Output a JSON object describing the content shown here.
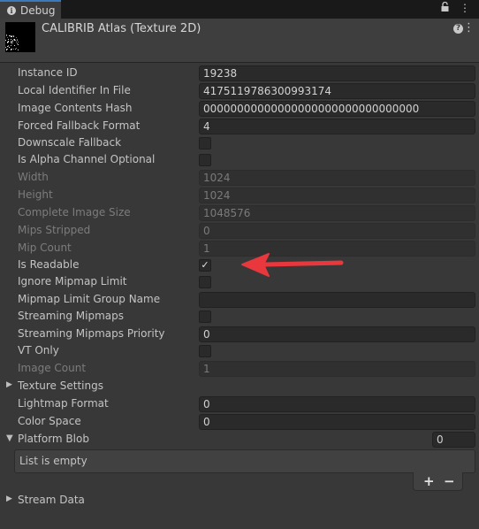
{
  "tab": {
    "title": "Debug"
  },
  "header": {
    "title": "CALIBRIB Atlas (Texture 2D)"
  },
  "properties": [
    {
      "label": "Instance ID",
      "kind": "field",
      "value": "19238",
      "enabled": true
    },
    {
      "label": "Local Identifier In File",
      "kind": "field",
      "value": "4175119786300993174",
      "enabled": true
    },
    {
      "label": "Image Contents Hash",
      "kind": "field",
      "value": "00000000000000000000000000000000",
      "enabled": true
    },
    {
      "label": "Forced Fallback Format",
      "kind": "field",
      "value": "4",
      "enabled": true
    },
    {
      "label": "Downscale Fallback",
      "kind": "checkbox",
      "checked": false,
      "enabled": true
    },
    {
      "label": "Is Alpha Channel Optional",
      "kind": "checkbox",
      "checked": false,
      "enabled": true
    },
    {
      "label": "Width",
      "kind": "field",
      "value": "1024",
      "enabled": false
    },
    {
      "label": "Height",
      "kind": "field",
      "value": "1024",
      "enabled": false
    },
    {
      "label": "Complete Image Size",
      "kind": "field",
      "value": "1048576",
      "enabled": false
    },
    {
      "label": "Mips Stripped",
      "kind": "field",
      "value": "0",
      "enabled": false
    },
    {
      "label": "Mip Count",
      "kind": "field",
      "value": "1",
      "enabled": false
    },
    {
      "label": "Is Readable",
      "kind": "checkbox",
      "checked": true,
      "enabled": true
    },
    {
      "label": "Ignore Mipmap Limit",
      "kind": "checkbox",
      "checked": false,
      "enabled": true
    },
    {
      "label": "Mipmap Limit Group Name",
      "kind": "field",
      "value": "",
      "enabled": true
    },
    {
      "label": "Streaming Mipmaps",
      "kind": "checkbox",
      "checked": false,
      "enabled": true
    },
    {
      "label": "Streaming Mipmaps Priority",
      "kind": "field",
      "value": "0",
      "enabled": true
    },
    {
      "label": "VT Only",
      "kind": "checkbox",
      "checked": false,
      "enabled": true
    },
    {
      "label": "Image Count",
      "kind": "field",
      "value": "1",
      "enabled": false
    },
    {
      "label": "Texture Settings",
      "kind": "foldout",
      "expanded": false,
      "enabled": true
    },
    {
      "label": "Lightmap Format",
      "kind": "field",
      "value": "0",
      "enabled": true
    },
    {
      "label": "Color Space",
      "kind": "field",
      "value": "0",
      "enabled": true
    }
  ],
  "platform_blob": {
    "label": "Platform Blob",
    "count": "0",
    "empty_text": "List is empty",
    "add": "+",
    "remove": "−"
  },
  "stream_data": {
    "label": "Stream Data"
  },
  "colors": {
    "annotation_arrow": "#e8383d",
    "tab_accent": "#3a79bb"
  }
}
